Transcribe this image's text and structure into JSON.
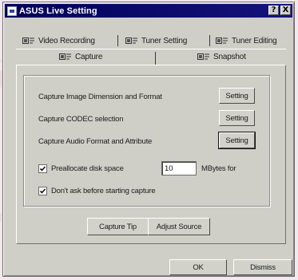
{
  "window": {
    "title": "ASUS Live Setting",
    "title_buttons": [
      "?",
      "X"
    ]
  },
  "tabs": {
    "row_back": [
      {
        "label": "Video Recording",
        "icon": "tv-tuner-icon"
      },
      {
        "label": "Tuner Setting",
        "icon": "tv-tuner-icon"
      },
      {
        "label": "Tuner Editing",
        "icon": "tv-tuner-icon"
      }
    ],
    "row_front": [
      {
        "label": "Capture",
        "icon": "tv-tuner-icon",
        "selected": true
      },
      {
        "label": "Snapshot",
        "icon": "tv-tuner-icon"
      }
    ]
  },
  "capture": {
    "rows": [
      {
        "label": "Capture Image Dimension and Format",
        "button": "Setting"
      },
      {
        "label": "Capture CODEC selection",
        "button": "Setting"
      },
      {
        "label": "Capture Audio Format and Attribute",
        "button": "Setting"
      }
    ],
    "preallocate": {
      "checked": true,
      "label": "Preallocate disk space",
      "value": "10",
      "unit": "MBytes for"
    },
    "dont_ask": {
      "checked": true,
      "label": "Don't ask before starting capture"
    },
    "capture_tip_label": "Capture Tip",
    "adjust_source_label": "Adjust Source"
  },
  "footer": {
    "ok_label": "OK",
    "dismiss_label": "Dismiss"
  }
}
